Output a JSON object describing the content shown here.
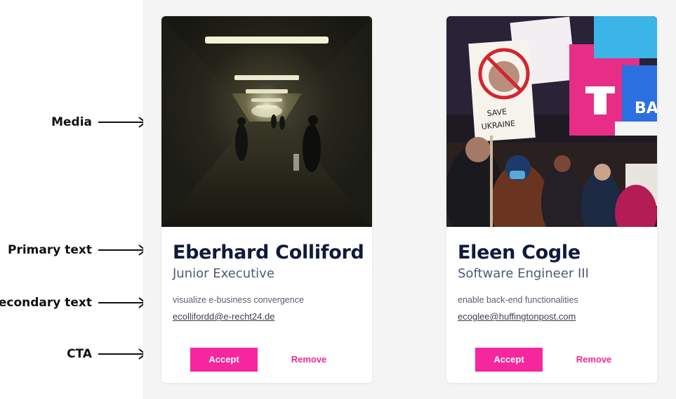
{
  "annotations": [
    {
      "label": "Media"
    },
    {
      "label": "Primary text"
    },
    {
      "label": "Secondary text"
    },
    {
      "label": "CTA"
    }
  ],
  "cards": [
    {
      "name": "Eberhard Colliford",
      "role": "Junior Executive",
      "tagline": "visualize e-business convergence",
      "email": "ecollifordd@e-recht24.de",
      "accept_label": "Accept",
      "remove_label": "Remove"
    },
    {
      "name": "Eleen Cogle",
      "role": "Software Engineer III",
      "tagline": "enable back-end functionalities",
      "email": "ecoglee@huffingtonpost.com",
      "accept_label": "Accept",
      "remove_label": "Remove"
    }
  ],
  "colors": {
    "accent": "#f6269e",
    "name_text": "#0f1a3c",
    "role_text": "#4e5a74",
    "canvas_bg": "#f4f4f4",
    "card_bg": "#ffffff"
  }
}
